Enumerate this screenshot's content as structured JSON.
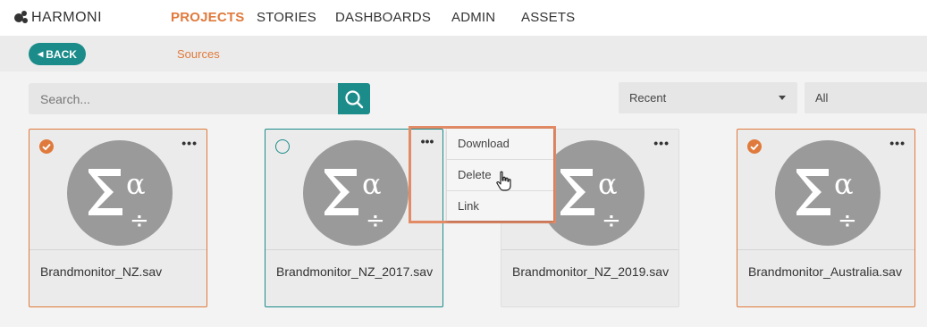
{
  "brand": {
    "name": "HARMONI"
  },
  "nav": {
    "items": [
      {
        "label": "PROJECTS",
        "active": true
      },
      {
        "label": "STORIES",
        "active": false
      },
      {
        "label": "DASHBOARDS",
        "active": false
      },
      {
        "label": "ADMIN",
        "active": false
      },
      {
        "label": "ASSETS",
        "active": false
      }
    ]
  },
  "subbar": {
    "back_label": "BACK",
    "breadcrumb": "Sources"
  },
  "search": {
    "placeholder": "Search..."
  },
  "filters": {
    "sort_value": "Recent",
    "scope_value": "All"
  },
  "cards": [
    {
      "name": "Brandmonitor_NZ.sav",
      "state": "checked",
      "icon": "sigma-alpha-divide-icon"
    },
    {
      "name": "Brandmonitor_NZ_2017.sav",
      "state": "unchecked",
      "icon": "sigma-alpha-divide-icon"
    },
    {
      "name": "Brandmonitor_NZ_2019.sav",
      "state": "none",
      "icon": "sigma-alpha-divide-icon"
    },
    {
      "name": "Brandmonitor_Australia.sav",
      "state": "checked",
      "icon": "sigma-alpha-divide-icon"
    }
  ],
  "context_menu": {
    "items": [
      {
        "label": "Download"
      },
      {
        "label": "Delete"
      },
      {
        "label": "Link"
      }
    ]
  },
  "colors": {
    "accent_orange": "#e07a3c",
    "accent_teal": "#1c8c8a",
    "icon_gray": "#9a9a9a"
  }
}
